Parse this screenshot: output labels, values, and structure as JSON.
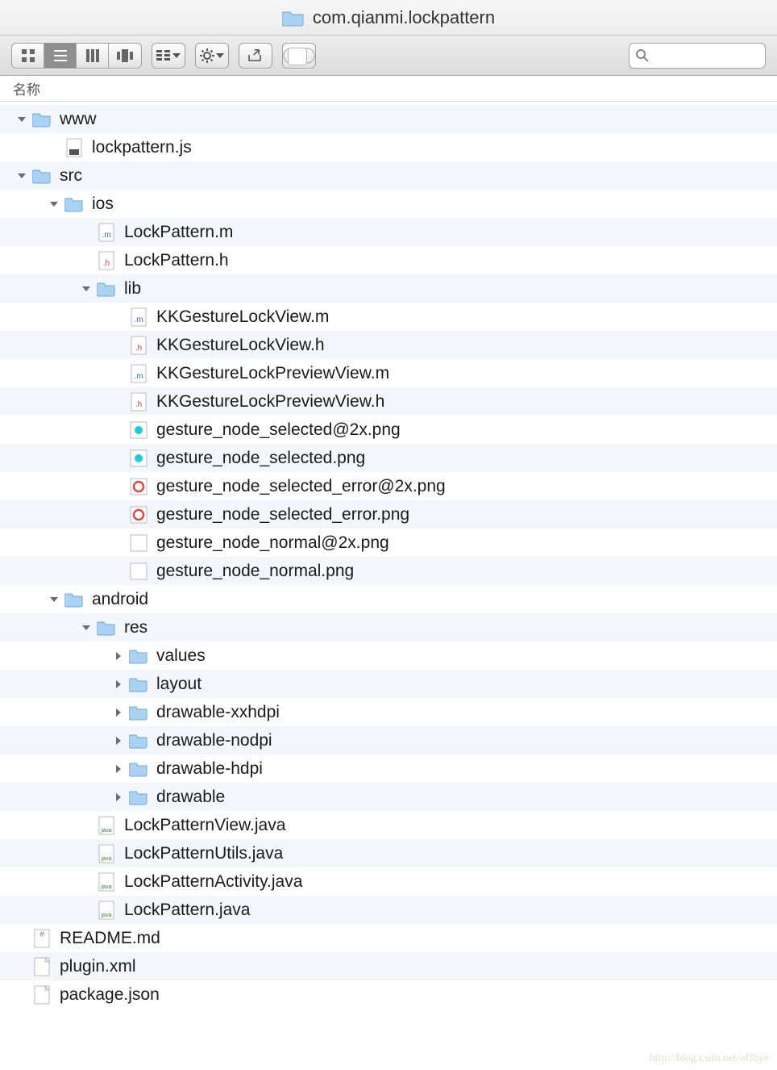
{
  "window": {
    "title": "com.qianmi.lockpattern"
  },
  "toolbar": {
    "view_icon": "icon-view-icon",
    "view_list": "list-view-icon",
    "view_column": "column-view-icon",
    "view_coverflow": "coverflow-view-icon",
    "arrange": "arrange-icon",
    "action": "gear-icon",
    "share": "share-icon",
    "tags": "toggle-icon"
  },
  "search": {
    "placeholder": ""
  },
  "columns": {
    "name": "名称"
  },
  "tree": [
    {
      "depth": 0,
      "type": "folder",
      "expanded": true,
      "label": "www"
    },
    {
      "depth": 1,
      "type": "js",
      "label": "lockpattern.js"
    },
    {
      "depth": 0,
      "type": "folder",
      "expanded": true,
      "label": "src"
    },
    {
      "depth": 1,
      "type": "folder",
      "expanded": true,
      "label": "ios"
    },
    {
      "depth": 2,
      "type": "m",
      "label": "LockPattern.m"
    },
    {
      "depth": 2,
      "type": "h",
      "label": "LockPattern.h"
    },
    {
      "depth": 2,
      "type": "folder",
      "expanded": true,
      "label": "lib"
    },
    {
      "depth": 3,
      "type": "m",
      "label": "KKGestureLockView.m"
    },
    {
      "depth": 3,
      "type": "h",
      "label": "KKGestureLockView.h"
    },
    {
      "depth": 3,
      "type": "m",
      "label": "KKGestureLockPreviewView.m"
    },
    {
      "depth": 3,
      "type": "h",
      "label": "KKGestureLockPreviewView.h"
    },
    {
      "depth": 3,
      "type": "png-cyan",
      "label": "gesture_node_selected@2x.png"
    },
    {
      "depth": 3,
      "type": "png-cyan",
      "label": "gesture_node_selected.png"
    },
    {
      "depth": 3,
      "type": "png-redring",
      "label": "gesture_node_selected_error@2x.png"
    },
    {
      "depth": 3,
      "type": "png-redring",
      "label": "gesture_node_selected_error.png"
    },
    {
      "depth": 3,
      "type": "png-blank",
      "label": "gesture_node_normal@2x.png"
    },
    {
      "depth": 3,
      "type": "png-blank",
      "label": "gesture_node_normal.png"
    },
    {
      "depth": 1,
      "type": "folder",
      "expanded": true,
      "label": "android"
    },
    {
      "depth": 2,
      "type": "folder",
      "expanded": true,
      "label": "res"
    },
    {
      "depth": 3,
      "type": "folder",
      "expanded": false,
      "label": "values"
    },
    {
      "depth": 3,
      "type": "folder",
      "expanded": false,
      "label": "layout"
    },
    {
      "depth": 3,
      "type": "folder",
      "expanded": false,
      "label": "drawable-xxhdpi"
    },
    {
      "depth": 3,
      "type": "folder",
      "expanded": false,
      "label": "drawable-nodpi"
    },
    {
      "depth": 3,
      "type": "folder",
      "expanded": false,
      "label": "drawable-hdpi"
    },
    {
      "depth": 3,
      "type": "folder",
      "expanded": false,
      "label": "drawable"
    },
    {
      "depth": 2,
      "type": "java",
      "label": "LockPatternView.java"
    },
    {
      "depth": 2,
      "type": "java",
      "label": "LockPatternUtils.java"
    },
    {
      "depth": 2,
      "type": "java",
      "label": "LockPatternActivity.java"
    },
    {
      "depth": 2,
      "type": "java",
      "label": "LockPattern.java"
    },
    {
      "depth": 0,
      "type": "md",
      "label": "README.md"
    },
    {
      "depth": 0,
      "type": "xml",
      "label": "plugin.xml"
    },
    {
      "depth": 0,
      "type": "doc",
      "label": "package.json"
    }
  ],
  "watermark": "http://blog.csdn.net/offbye"
}
